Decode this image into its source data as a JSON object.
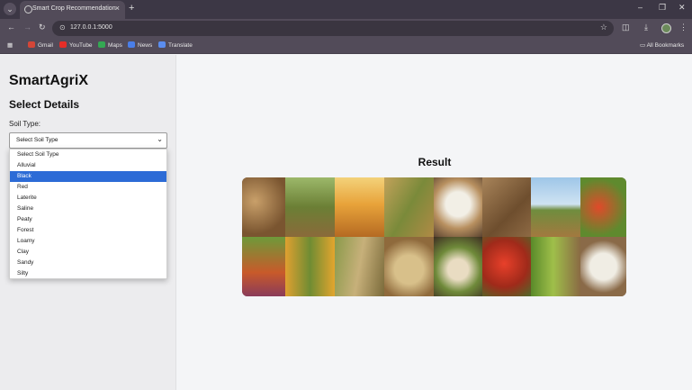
{
  "browser": {
    "tab_title": "Smart Crop Recommendation",
    "url": "127.0.0.1:5000",
    "bookmarks": [
      "Gmail",
      "YouTube",
      "Maps",
      "News",
      "Translate"
    ],
    "all_bookmarks": "All Bookmarks"
  },
  "sidebar": {
    "app_title": "SmartAgriX",
    "section_title": "Select Details",
    "soil_label": "Soil Type:",
    "soil_selected": "Select Soil Type",
    "soil_options": [
      "Select Soil Type",
      "Alluvial",
      "Black",
      "Red",
      "Laterite",
      "Saline",
      "Peaty",
      "Forest",
      "Loamy",
      "Clay",
      "Sandy",
      "Silty"
    ],
    "highlighted_option": "Black"
  },
  "main": {
    "result_heading": "Result"
  },
  "icons": {
    "back": "back-arrow-icon",
    "forward": "forward-arrow-icon",
    "reload": "reload-icon",
    "site_info": "site-info-icon",
    "bookmark_star": "star-icon",
    "extensions": "extensions-icon",
    "download": "download-icon",
    "menu": "kebab-menu-icon"
  }
}
